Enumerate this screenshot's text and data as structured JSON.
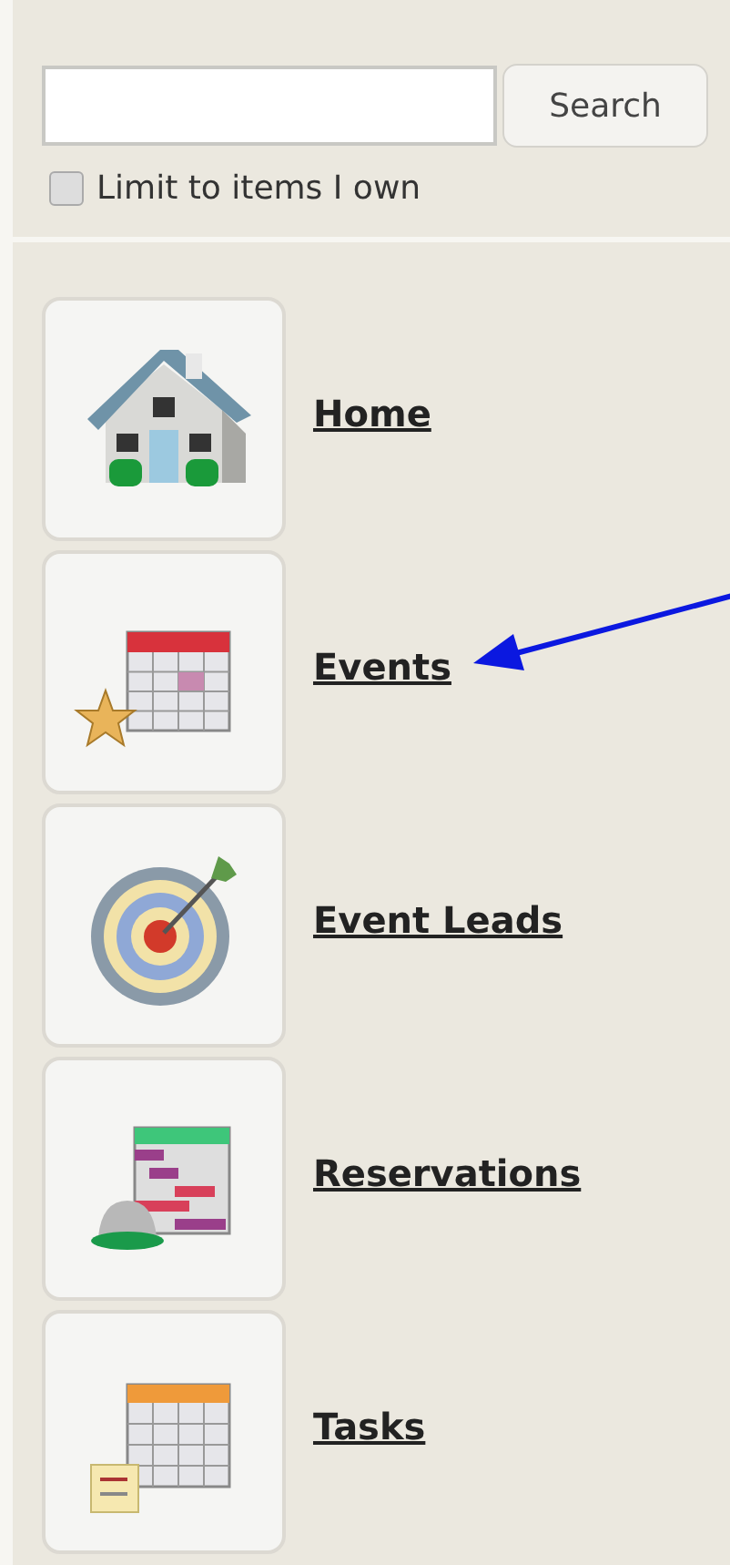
{
  "search": {
    "button": "Search"
  },
  "limit": {
    "label": "Limit to items I own",
    "checked": false
  },
  "nav_items": [
    {
      "kind": "house",
      "label": "Home"
    },
    {
      "kind": "events",
      "label": "Events"
    },
    {
      "kind": "target",
      "label": "Event Leads"
    },
    {
      "kind": "reservations",
      "label": "Reservations"
    },
    {
      "kind": "tasks",
      "label": "Tasks"
    }
  ]
}
